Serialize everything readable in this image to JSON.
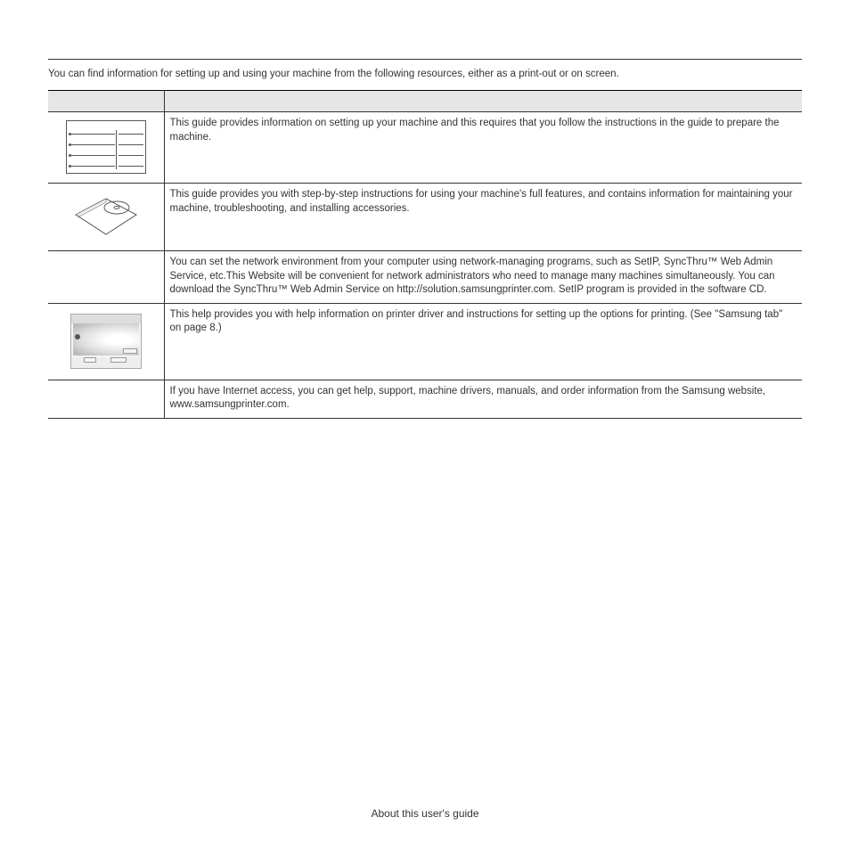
{
  "intro": "You can find information for setting up and using your machine from the following resources, either as a print-out or on screen.",
  "rows": {
    "r0": "This guide provides information on setting up your machine and this requires that you follow the instructions in the guide to prepare the machine.",
    "r1": "This guide provides you with step-by-step instructions for using your machine's full features, and contains information for maintaining your machine, troubleshooting, and installing accessories.",
    "r2": "You can set the network environment from your computer using network-managing programs, such as SetIP, SyncThru™ Web Admin Service, etc.This Website will be convenient for network administrators who need to manage many machines simultaneously. You can download the SyncThru™ Web Admin Service on http://solution.samsungprinter.com. SetIP program is provided in the software CD.",
    "r3": "This help provides you with help information on printer driver and instructions for setting up the options for printing. (See \"Samsung tab\" on page 8.)",
    "r4": "If you have Internet access, you can get help, support, machine drivers, manuals, and order information from the Samsung website, www.samsungprinter.com."
  },
  "footer": "About this user's guide"
}
